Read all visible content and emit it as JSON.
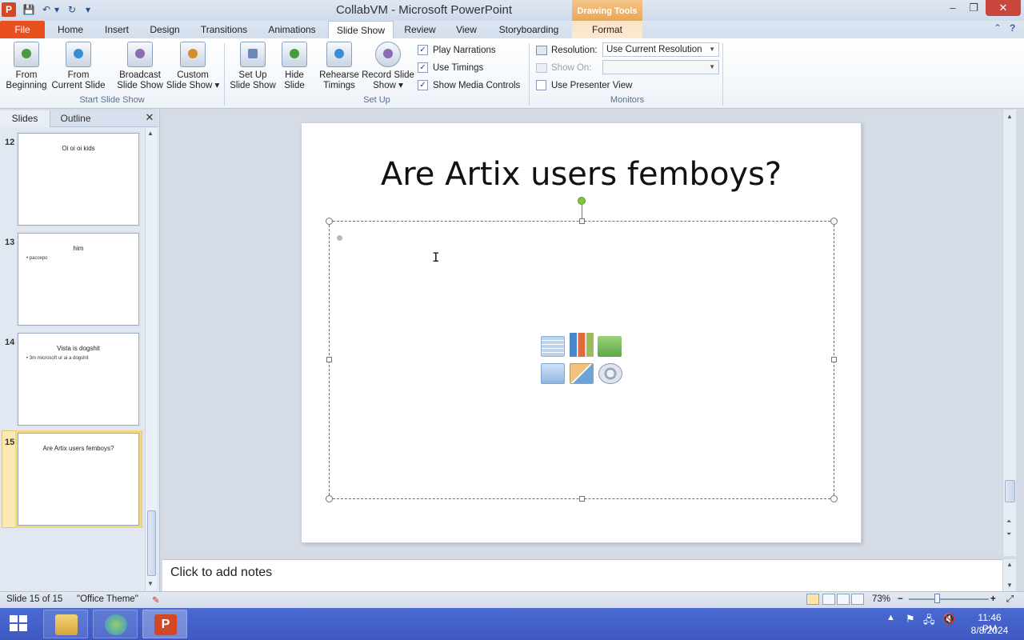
{
  "window": {
    "title": "CollabVM - Microsoft PowerPoint",
    "contextual_tab_group": "Drawing Tools",
    "minimize": "–",
    "maximize": "❐",
    "close": "✕"
  },
  "qat": {
    "save": "💾",
    "undo": "↶",
    "undo_dd": "▾",
    "redo": "↻",
    "customize": "▾"
  },
  "tabs": [
    "File",
    "Home",
    "Insert",
    "Design",
    "Transitions",
    "Animations",
    "Slide Show",
    "Review",
    "View",
    "Storyboarding",
    "Format"
  ],
  "active_tab": "Slide Show",
  "help": {
    "collapse": "⌃",
    "help": "?"
  },
  "ribbon": {
    "start_group": {
      "label": "Start Slide Show",
      "from_beginning": [
        "From",
        "Beginning"
      ],
      "from_current": [
        "From",
        "Current Slide"
      ],
      "broadcast": [
        "Broadcast",
        "Slide Show"
      ],
      "custom": [
        "Custom",
        "Slide Show ▾"
      ]
    },
    "setup_group": {
      "label": "Set Up",
      "setup": [
        "Set Up",
        "Slide Show"
      ],
      "hide": [
        "Hide",
        "Slide"
      ],
      "rehearse": [
        "Rehearse",
        "Timings"
      ],
      "record": [
        "Record Slide",
        "Show ▾"
      ],
      "play_narrations": {
        "label": "Play Narrations",
        "checked": true
      },
      "use_timings": {
        "label": "Use Timings",
        "checked": true
      },
      "show_media": {
        "label": "Show Media Controls",
        "checked": true
      }
    },
    "monitors_group": {
      "label": "Monitors",
      "resolution_label": "Resolution:",
      "resolution_value": "Use Current Resolution",
      "show_on_label": "Show On:",
      "show_on_value": "",
      "presenter_view": {
        "label": "Use Presenter View",
        "checked": false
      }
    }
  },
  "panel": {
    "tabs": [
      "Slides",
      "Outline"
    ],
    "close": "✕",
    "slides": [
      {
        "num": "12",
        "title": "Oi oi oi kids",
        "bullet": ""
      },
      {
        "num": "13",
        "title": "him",
        "bullet": "• pacoxpo"
      },
      {
        "num": "14",
        "title": "Vista is dogshit",
        "bullet": "• 3m microsoft ur ai a dogshit"
      },
      {
        "num": "15",
        "title": "Are Artix users femboys?",
        "bullet": ""
      }
    ]
  },
  "slide": {
    "title": "Are Artix users femboys?"
  },
  "notes": {
    "placeholder": "Click to add notes"
  },
  "status": {
    "slide_info": "Slide 15 of 15",
    "theme": "\"Office Theme\"",
    "zoom": "73%",
    "zoom_out": "−",
    "zoom_in": "+",
    "fit": "⤢"
  },
  "taskbar": {
    "time": "11:46 PM",
    "date": "8/8/2024"
  },
  "colors": {
    "file_tab": "#e8501f",
    "drawing_tools": "#e8a34f",
    "taskbar": "#4262c9",
    "selection": "#f5d77e"
  }
}
